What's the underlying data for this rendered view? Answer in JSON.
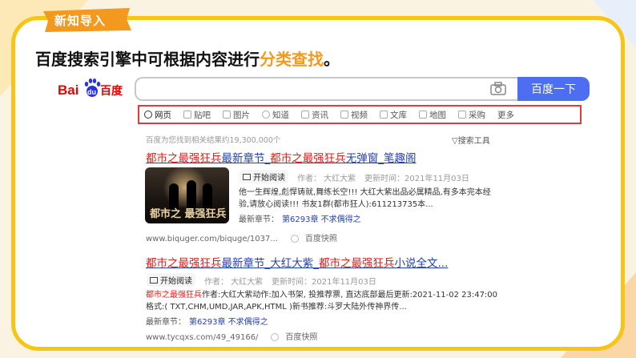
{
  "badge": {
    "text": "新知导入"
  },
  "headline": {
    "text_main": "百度搜索引擎中可根据内容进行",
    "text_highlight": "分类查找",
    "text_end": "。"
  },
  "logo": {
    "text_bai": "Bai",
    "text_du": "du",
    "text_cn": "百度"
  },
  "search": {
    "value": "",
    "button_label": "百度一下"
  },
  "tabs": [
    {
      "label": "网页",
      "icon": "search-icon"
    },
    {
      "label": "贴吧",
      "icon": "tieba-icon"
    },
    {
      "label": "图片",
      "icon": "image-icon"
    },
    {
      "label": "知道",
      "icon": "question-icon"
    },
    {
      "label": "资讯",
      "icon": "news-icon"
    },
    {
      "label": "视频",
      "icon": "video-icon"
    },
    {
      "label": "文库",
      "icon": "doc-icon"
    },
    {
      "label": "地图",
      "icon": "map-icon"
    },
    {
      "label": "采购",
      "icon": "cart-icon"
    },
    {
      "label": "更多",
      "icon": ""
    }
  ],
  "results_info": "百度为您找到相关结果约19,300,000个",
  "search_tools": "搜索工具",
  "results": [
    {
      "title_a": "都市之最强狂兵",
      "title_b": "最新章节",
      "title_c": "_",
      "title_d": "都市之最强狂兵",
      "title_e": "无弹窗_笔趣阁",
      "thumb_text": "都市之 最强狂兵",
      "read_label": "开始阅读",
      "author": "作者： 大红大紫",
      "updated": "更新时间：2021年11月03日",
      "snippet_line1": "他一生辉煌,彪悍铸就,舞练长空!!! 大红大紫出品必属精品,有多本完本经",
      "snippet_line2": "验,请放心阅读!!! 书友1群(都市狂人):611213735本...",
      "latest_label": "最新章节：",
      "latest_link": "第6293章 不求偶得之",
      "url": "www.biquger.com/biquge/1037...",
      "snapshot": "百度快照"
    },
    {
      "title_a": "都市之最强狂兵",
      "title_b": "最新章节_大红大紫_",
      "title_d": "都市之最强狂兵",
      "title_e": "小说全文...",
      "read_label": "开始阅读",
      "author": "作者： 大红大紫",
      "updated": "更新时间：2021年11月03日",
      "snippet_red": "都市之最强狂兵",
      "snippet_line1": "作者:大红大紫动作:加入书架, 投推荐票, 直达底部最后更新:2021-11-02 23:47:00",
      "snippet_line2": "格式:( TXT,CHM,UMD,JAR,APK,HTML )新书推荐:斗罗大陆外传神界传...",
      "latest_label": "最新章节：",
      "latest_link": "第6293章 不求偶得之",
      "url": "www.tycqxs.com/49_49166/",
      "snapshot": "百度快照"
    }
  ],
  "colors": {
    "accent_orange": "#f39a1e",
    "frame_yellow": "#f5c518",
    "baidu_blue": "#4e6ef2",
    "link_blue": "#2440b3",
    "keyword_red": "#e02020"
  }
}
